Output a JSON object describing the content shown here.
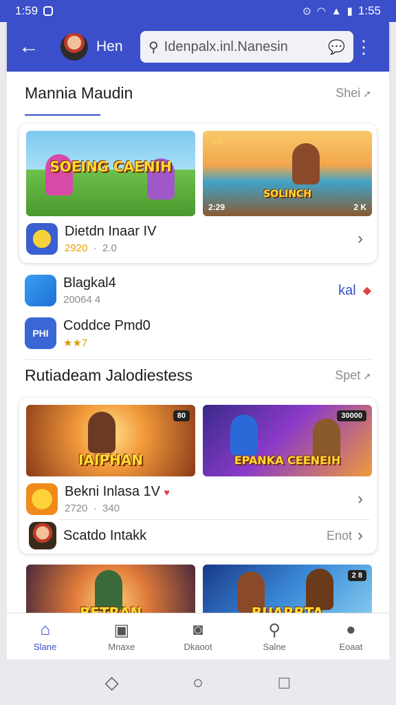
{
  "status": {
    "time": "1:59",
    "clock_right": "1:55"
  },
  "appbar": {
    "title": "Hen",
    "search_text": "Idenpalx.inl.Nanesin"
  },
  "section1": {
    "title": "Mannia Maudin",
    "link": "Shei"
  },
  "section1_card": {
    "thumb1_label": "SOEING CAENIH",
    "thumb2_badge": "2 8",
    "thumb2_label": "SOLINCH",
    "thumb2_corner_left": "2:29",
    "thumb2_corner_right": "2 K",
    "item_name": "Dietdn Inaar IV",
    "item_meta_1": "2920",
    "item_meta_2": "2.0"
  },
  "list1": [
    {
      "name": "Blagkal4",
      "meta": "20064 4",
      "action": "kal"
    },
    {
      "name": "Coddce Pmd0",
      "meta": "★★7",
      "icon_text": "PHI"
    }
  ],
  "section2": {
    "title": "Rutiadeam Jalodiestess",
    "link": "Spet"
  },
  "section2_card": {
    "thumb1_label": "IAIPHAN",
    "thumb1_badge": "80",
    "thumb2_label": "EPANKA CEENEIH",
    "thumb2_badge": "30000",
    "item1_name": "Bekni Inlasa 1V",
    "item1_meta_1": "2720",
    "item1_meta_2": "340",
    "item2_name": "Scatdo Intakk",
    "item2_action": "Enot"
  },
  "section3": {
    "thumb1_label": "BETRAN",
    "thumb2_label": "BUARBTA",
    "thumb2_badge": "2 8"
  },
  "tabs": [
    {
      "label": "Slane",
      "icon": "home-icon"
    },
    {
      "label": "Mnaxe",
      "icon": "news-icon"
    },
    {
      "label": "Dkaoot",
      "icon": "media-icon"
    },
    {
      "label": "Salne",
      "icon": "search-icon"
    },
    {
      "label": "Eoaat",
      "icon": "profile-icon"
    }
  ],
  "colors": {
    "accent": "#3a4fc9",
    "favorite": "#e24040"
  }
}
